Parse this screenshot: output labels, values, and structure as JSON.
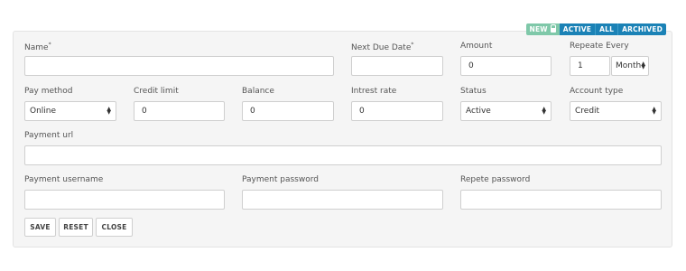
{
  "status_tags": {
    "new": "NEW",
    "active": "ACTIVE",
    "all": "ALL",
    "archived": "ARCHIVED"
  },
  "fields": {
    "name": {
      "label": "Name",
      "required_mark": "*",
      "value": ""
    },
    "next_due_date": {
      "label": "Next Due Date",
      "required_mark": "*",
      "value": ""
    },
    "amount": {
      "label": "Amount",
      "value": "0"
    },
    "repeate_every": {
      "label": "Repeate Every",
      "value": "1",
      "unit": "Month"
    },
    "pay_method": {
      "label": "Pay method",
      "value": "Online"
    },
    "credit_limit": {
      "label": "Credit limit",
      "value": "0"
    },
    "balance": {
      "label": "Balance",
      "value": "0"
    },
    "intrest_rate": {
      "label": "Intrest rate",
      "value": "0"
    },
    "status": {
      "label": "Status",
      "value": "Active"
    },
    "account_type": {
      "label": "Account type",
      "value": "Credit"
    },
    "payment_url": {
      "label": "Payment url",
      "value": ""
    },
    "payment_username": {
      "label": "Payment username",
      "value": ""
    },
    "payment_password": {
      "label": "Payment password",
      "value": ""
    },
    "repete_password": {
      "label": "Repete password",
      "value": ""
    }
  },
  "buttons": {
    "save": "SAVE",
    "reset": "RESET",
    "close": "CLOSE"
  },
  "colors": {
    "accent": "#1b82b6",
    "new_tag": "#7fc8a9",
    "panel_bg": "#f5f5f5"
  },
  "icons": {
    "lock": "lock-icon",
    "select_arrows": "updown-arrows-icon"
  }
}
